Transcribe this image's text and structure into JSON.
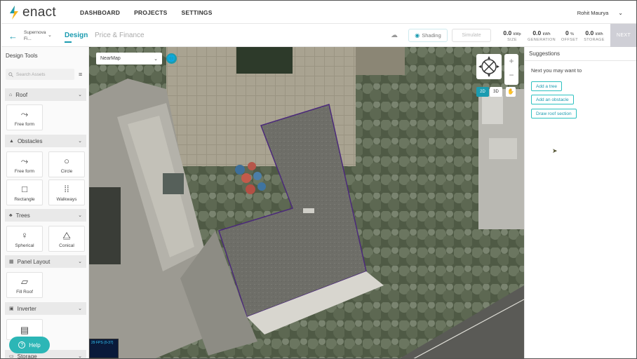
{
  "nav": {
    "logo": "enact",
    "links": [
      "DASHBOARD",
      "PROJECTS",
      "SETTINGS"
    ],
    "user": "Rohit Maurya",
    "user_chevron": "⌄"
  },
  "subbar": {
    "back_icon": "←",
    "project_name": "Supernova Fi...",
    "project_chevron": "⌄",
    "tabs": [
      "Design",
      "Price & Finance"
    ],
    "shading_label": "Shading",
    "simulate_label": "Simulate",
    "stats": [
      {
        "value": "0.0",
        "unit": "kWp",
        "label": "SIZE"
      },
      {
        "value": "0.0",
        "unit": "kWh",
        "label": "GENERATION"
      },
      {
        "value": "0",
        "unit": "%",
        "label": "OFFSET"
      },
      {
        "value": "0.0",
        "unit": "kWh",
        "label": "STORAGE"
      }
    ],
    "next_label": "NEXT"
  },
  "design_tools": {
    "title": "Design Tools",
    "search_placeholder": "Search Assets",
    "sections": [
      {
        "label": "Roof",
        "icon": "roof-icon",
        "items": [
          {
            "label": "Free form",
            "icon": "freeform-icon"
          }
        ]
      },
      {
        "label": "Obstacles",
        "icon": "obstacle-icon",
        "items": [
          {
            "label": "Free form",
            "icon": "freeform-icon"
          },
          {
            "label": "Circle",
            "icon": "circle-icon"
          },
          {
            "label": "Rectangle",
            "icon": "rectangle-icon"
          },
          {
            "label": "Walkways",
            "icon": "walkway-icon"
          }
        ]
      },
      {
        "label": "Trees",
        "icon": "tree-icon",
        "items": [
          {
            "label": "Spherical",
            "icon": "spherical-tree-icon"
          },
          {
            "label": "Conical",
            "icon": "conical-tree-icon"
          }
        ]
      },
      {
        "label": "Panel Layout",
        "icon": "panel-icon",
        "items": [
          {
            "label": "Fill Roof",
            "icon": "fill-roof-icon"
          }
        ]
      },
      {
        "label": "Inverter",
        "icon": "inverter-icon",
        "items": [
          {
            "label": "",
            "icon": "inverter-device-icon"
          }
        ]
      },
      {
        "label": "Storage",
        "icon": "storage-icon",
        "items": []
      }
    ],
    "help_label": "Help"
  },
  "map": {
    "imagery_source": "NearMap",
    "view_2d": "2D",
    "view_3d": "3D",
    "fps": "29 FPS (0-37)"
  },
  "suggestions": {
    "title": "Suggestions",
    "prompt": "Next you may want to",
    "actions": [
      "Add a tree",
      "Add an obstacle",
      "Draw roof section"
    ]
  }
}
